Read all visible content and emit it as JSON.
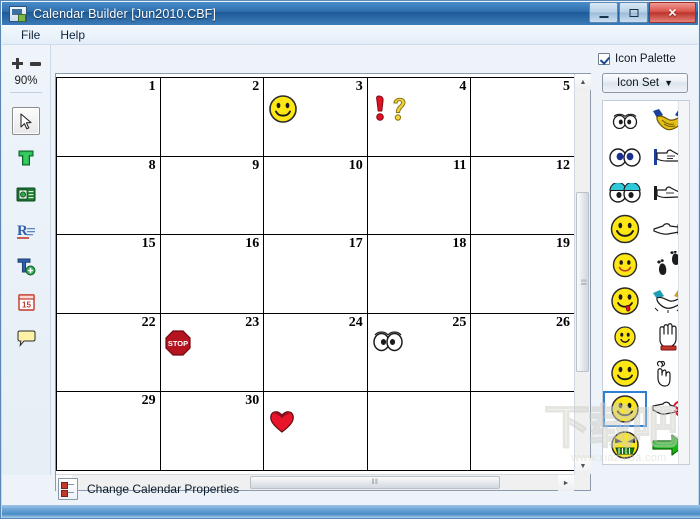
{
  "window": {
    "title": "Calendar Builder  [Jun2010.CBF]",
    "minimize_label": "–",
    "maximize_label": "□",
    "close_label": "✕"
  },
  "menubar": {
    "items": [
      {
        "label": "File"
      },
      {
        "label": "Help"
      }
    ]
  },
  "toolrail": {
    "zoom_in": "+",
    "zoom_out": "–",
    "zoom_level": "90%",
    "tools": [
      {
        "name": "select-arrow-tool",
        "selected": true
      },
      {
        "name": "text-tool",
        "selected": false
      },
      {
        "name": "image-tool",
        "selected": false
      },
      {
        "name": "rich-text-tool",
        "selected": false
      },
      {
        "name": "add-text-tool",
        "selected": false
      },
      {
        "name": "date-tool",
        "selected": false
      },
      {
        "name": "note-tool",
        "selected": false
      }
    ]
  },
  "calendar": {
    "rows": [
      [
        {
          "day": "1",
          "icon": ""
        },
        {
          "day": "2",
          "icon": ""
        },
        {
          "day": "3",
          "icon": "smiley"
        },
        {
          "day": "4",
          "icon": "exclaim-question"
        },
        {
          "day": "5",
          "icon": ""
        }
      ],
      [
        {
          "day": "8",
          "icon": ""
        },
        {
          "day": "9",
          "icon": ""
        },
        {
          "day": "10",
          "icon": ""
        },
        {
          "day": "11",
          "icon": ""
        },
        {
          "day": "12",
          "icon": ""
        }
      ],
      [
        {
          "day": "15",
          "icon": ""
        },
        {
          "day": "16",
          "icon": ""
        },
        {
          "day": "17",
          "icon": ""
        },
        {
          "day": "18",
          "icon": ""
        },
        {
          "day": "19",
          "icon": ""
        }
      ],
      [
        {
          "day": "22",
          "icon": ""
        },
        {
          "day": "23",
          "icon": "stop-sign"
        },
        {
          "day": "24",
          "icon": ""
        },
        {
          "day": "25",
          "icon": "eyes"
        },
        {
          "day": "26",
          "icon": ""
        }
      ],
      [
        {
          "day": "29",
          "icon": ""
        },
        {
          "day": "30",
          "icon": ""
        },
        {
          "day": "",
          "icon": "heart"
        },
        {
          "day": "",
          "icon": ""
        },
        {
          "day": "",
          "icon": ""
        }
      ]
    ]
  },
  "scrollbars": {
    "up_arrow": "▲",
    "down_arrow": "▼",
    "left_arrow": "◄",
    "right_arrow": "►",
    "grip": "‖‖"
  },
  "palette": {
    "checkbox_label": "Icon Palette",
    "checked": true,
    "iconset_label": "Icon Set",
    "iconset_caret": "▼",
    "icons": [
      {
        "name": "small-eyes-icon",
        "selected": false
      },
      {
        "name": "handshake-gold-icon",
        "selected": false
      },
      {
        "name": "big-eyes-icon",
        "selected": false
      },
      {
        "name": "pointing-hand-right-icon",
        "selected": false
      },
      {
        "name": "eyes-glasses-icon",
        "selected": false
      },
      {
        "name": "pointing-hand-outline-icon",
        "selected": false
      },
      {
        "name": "smiley-large-icon",
        "selected": false
      },
      {
        "name": "pointing-finger-icon",
        "selected": false
      },
      {
        "name": "smiley-small-icon",
        "selected": false
      },
      {
        "name": "footprints-icon",
        "selected": false
      },
      {
        "name": "smiley-tongue-icon",
        "selected": false
      },
      {
        "name": "handshake-blue-icon",
        "selected": false
      },
      {
        "name": "smiley-tiny-icon",
        "selected": false
      },
      {
        "name": "open-hand-icon",
        "selected": false
      },
      {
        "name": "smiley-plain-icon",
        "selected": false
      },
      {
        "name": "finger-bow-icon",
        "selected": false
      },
      {
        "name": "smiley-selected-icon",
        "selected": true
      },
      {
        "name": "hand-ribbon-icon",
        "selected": false
      },
      {
        "name": "angry-face-icon",
        "selected": false
      },
      {
        "name": "green-arrow-right-icon",
        "selected": false
      }
    ]
  },
  "statusbar": {
    "properties_label": "Change Calendar Properties"
  },
  "watermark": {
    "text": "下载吧",
    "url": "www.xiazaiba.com"
  },
  "colors": {
    "titlebar_blue": "#2f6fae",
    "close_red": "#d9534a",
    "selection_blue": "#2f7fd8",
    "smiley_yellow": "#ffeb18",
    "heart_red": "#e8142a",
    "green_arrow": "#13b814"
  }
}
